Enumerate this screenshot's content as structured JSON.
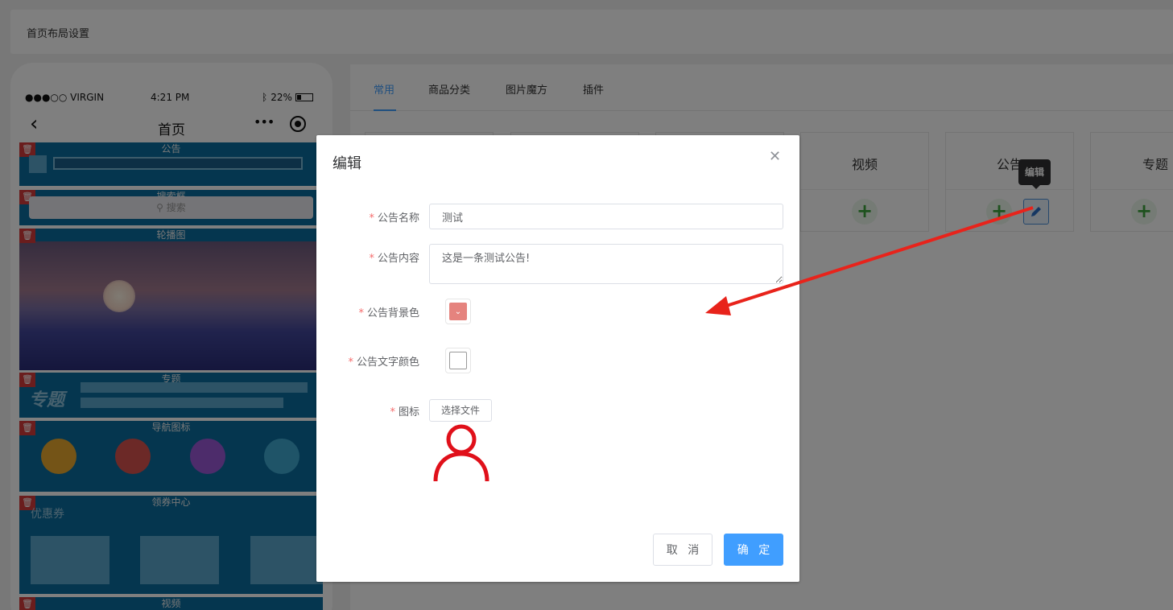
{
  "page_header": {
    "title": "首页布局设置"
  },
  "phone": {
    "status": {
      "carrier": "●●●○○ VIRGIN",
      "time": "4:21 PM",
      "battery": "22%"
    },
    "nav_title": "首页",
    "blocks": [
      {
        "label": "公告"
      },
      {
        "label": "搜索框",
        "search_placeholder": "搜索"
      },
      {
        "label": "轮播图"
      },
      {
        "label": "专题",
        "overlay_text": "专题"
      },
      {
        "label": "导航图标"
      },
      {
        "label": "领券中心",
        "overlay_text": "优惠券"
      },
      {
        "label": "视频"
      }
    ]
  },
  "tabs": [
    "常用",
    "商品分类",
    "图片魔方",
    "插件"
  ],
  "active_tab": "常用",
  "components": [
    {
      "name": "视频"
    },
    {
      "name": "公告"
    },
    {
      "name": "专题"
    }
  ],
  "tooltip": "编辑",
  "dialog": {
    "title": "编辑",
    "fields": {
      "notice_name": {
        "label": "公告名称",
        "value": "测试"
      },
      "notice_content": {
        "label": "公告内容",
        "value": "这是一条测试公告!"
      },
      "bg_color": {
        "label": "公告背景色",
        "color": "#e5837e"
      },
      "text_color": {
        "label": "公告文字颜色",
        "color": "#ffffff"
      },
      "icon": {
        "label": "图标",
        "button": "选择文件",
        "preview_icon": "user-icon"
      }
    },
    "cancel": "取 消",
    "confirm": "确 定"
  },
  "colors": {
    "primary": "#409eff",
    "danger": "#f56c6c",
    "annotation_arrow": "#e8231b"
  }
}
